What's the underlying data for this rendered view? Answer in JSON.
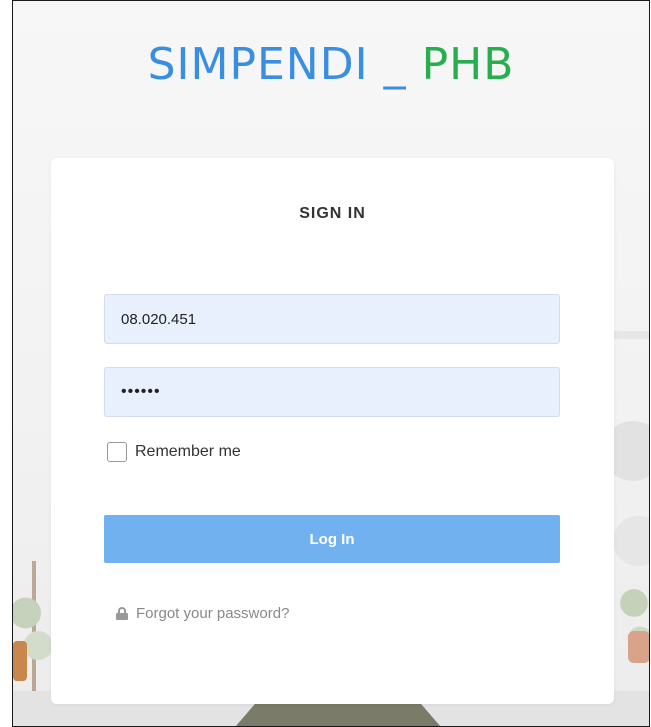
{
  "brand": {
    "part1": "SIMPENDI",
    "part2": "_",
    "part3": "PHB",
    "colors": {
      "blue": "#3a8ee0",
      "green": "#27ae4f"
    }
  },
  "login": {
    "title": "SIGN IN",
    "username_value": "08.020.451",
    "password_value": "••••••",
    "remember_label": "Remember me",
    "remember_checked": false,
    "submit_label": "Log In",
    "forgot_label": "Forgot your password?",
    "forgot_icon": "lock-icon",
    "button_color": "#71b1ef",
    "field_background": "#e8f0fe"
  }
}
